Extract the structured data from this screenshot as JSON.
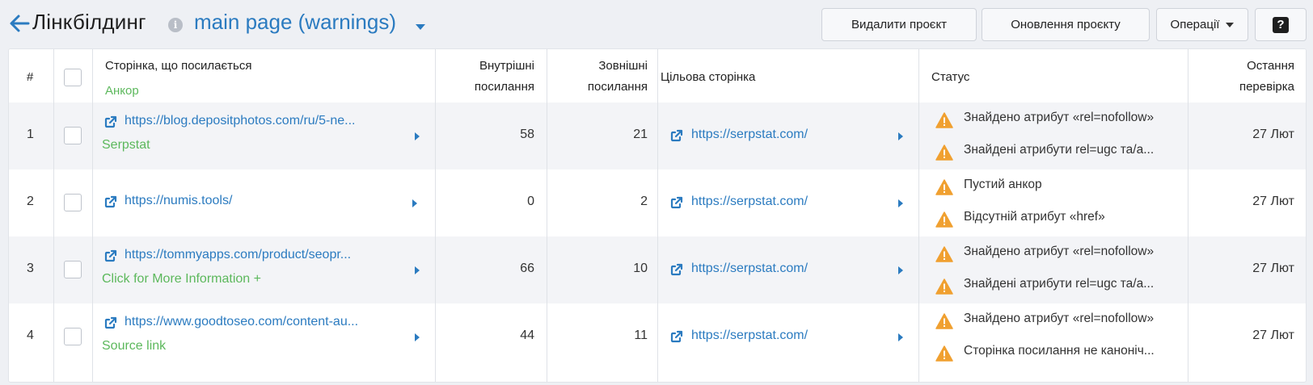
{
  "header": {
    "back_label": "←",
    "title": "Лінкбілдинг",
    "info_label": "i",
    "project_name": "main page (warnings)"
  },
  "toolbar": {
    "delete_label": "Видалити проєкт",
    "update_label": "Оновлення проєкту",
    "operations_label": "Операції",
    "help_label": "?"
  },
  "table": {
    "columns": {
      "num": "#",
      "referring_page": "Сторінка, що посилається",
      "anchor": "Анкор",
      "internal_links_1": "Внутрішні",
      "internal_links_2": "посилання",
      "external_links_1": "Зовнішні",
      "external_links_2": "посилання",
      "target_page": "Цільова сторінка",
      "status": "Статус",
      "last_check_1": "Остання",
      "last_check_2": "перевірка"
    },
    "rows": [
      {
        "num": "1",
        "url": "https://blog.depositphotos.com/ru/5-ne...",
        "anchor": "Serpstat",
        "internal": "58",
        "external": "21",
        "target": "https://serpstat.com/",
        "statuses": [
          "Знайдено атрибут «rel=nofollow»",
          "Знайдені атрибути rel=ugc та/а..."
        ],
        "date": "27 Лют"
      },
      {
        "num": "2",
        "url": "https://numis.tools/",
        "anchor": "",
        "internal": "0",
        "external": "2",
        "target": "https://serpstat.com/",
        "statuses": [
          "Пустий анкор",
          "Відсутній атрибут «href»"
        ],
        "date": "27 Лют"
      },
      {
        "num": "3",
        "url": "https://tommyapps.com/product/seopr...",
        "anchor": "Click for More Information +",
        "internal": "66",
        "external": "10",
        "target": "https://serpstat.com/",
        "statuses": [
          "Знайдено атрибут «rel=nofollow»",
          "Знайдені атрибути rel=ugc та/а..."
        ],
        "date": "27 Лют"
      },
      {
        "num": "4",
        "url": "https://www.goodtoseo.com/content-au...",
        "anchor": "Source link",
        "internal": "44",
        "external": "11",
        "target": "https://serpstat.com/",
        "statuses": [
          "Знайдено атрибут «rel=nofollow»",
          "Сторінка посилання не каноніч..."
        ],
        "date": "27 Лют"
      }
    ]
  },
  "colors": {
    "link": "#2b7bc0",
    "anchor": "#5cb85c",
    "warning": "#f0a030",
    "alt_row": "#f3f4f7"
  }
}
